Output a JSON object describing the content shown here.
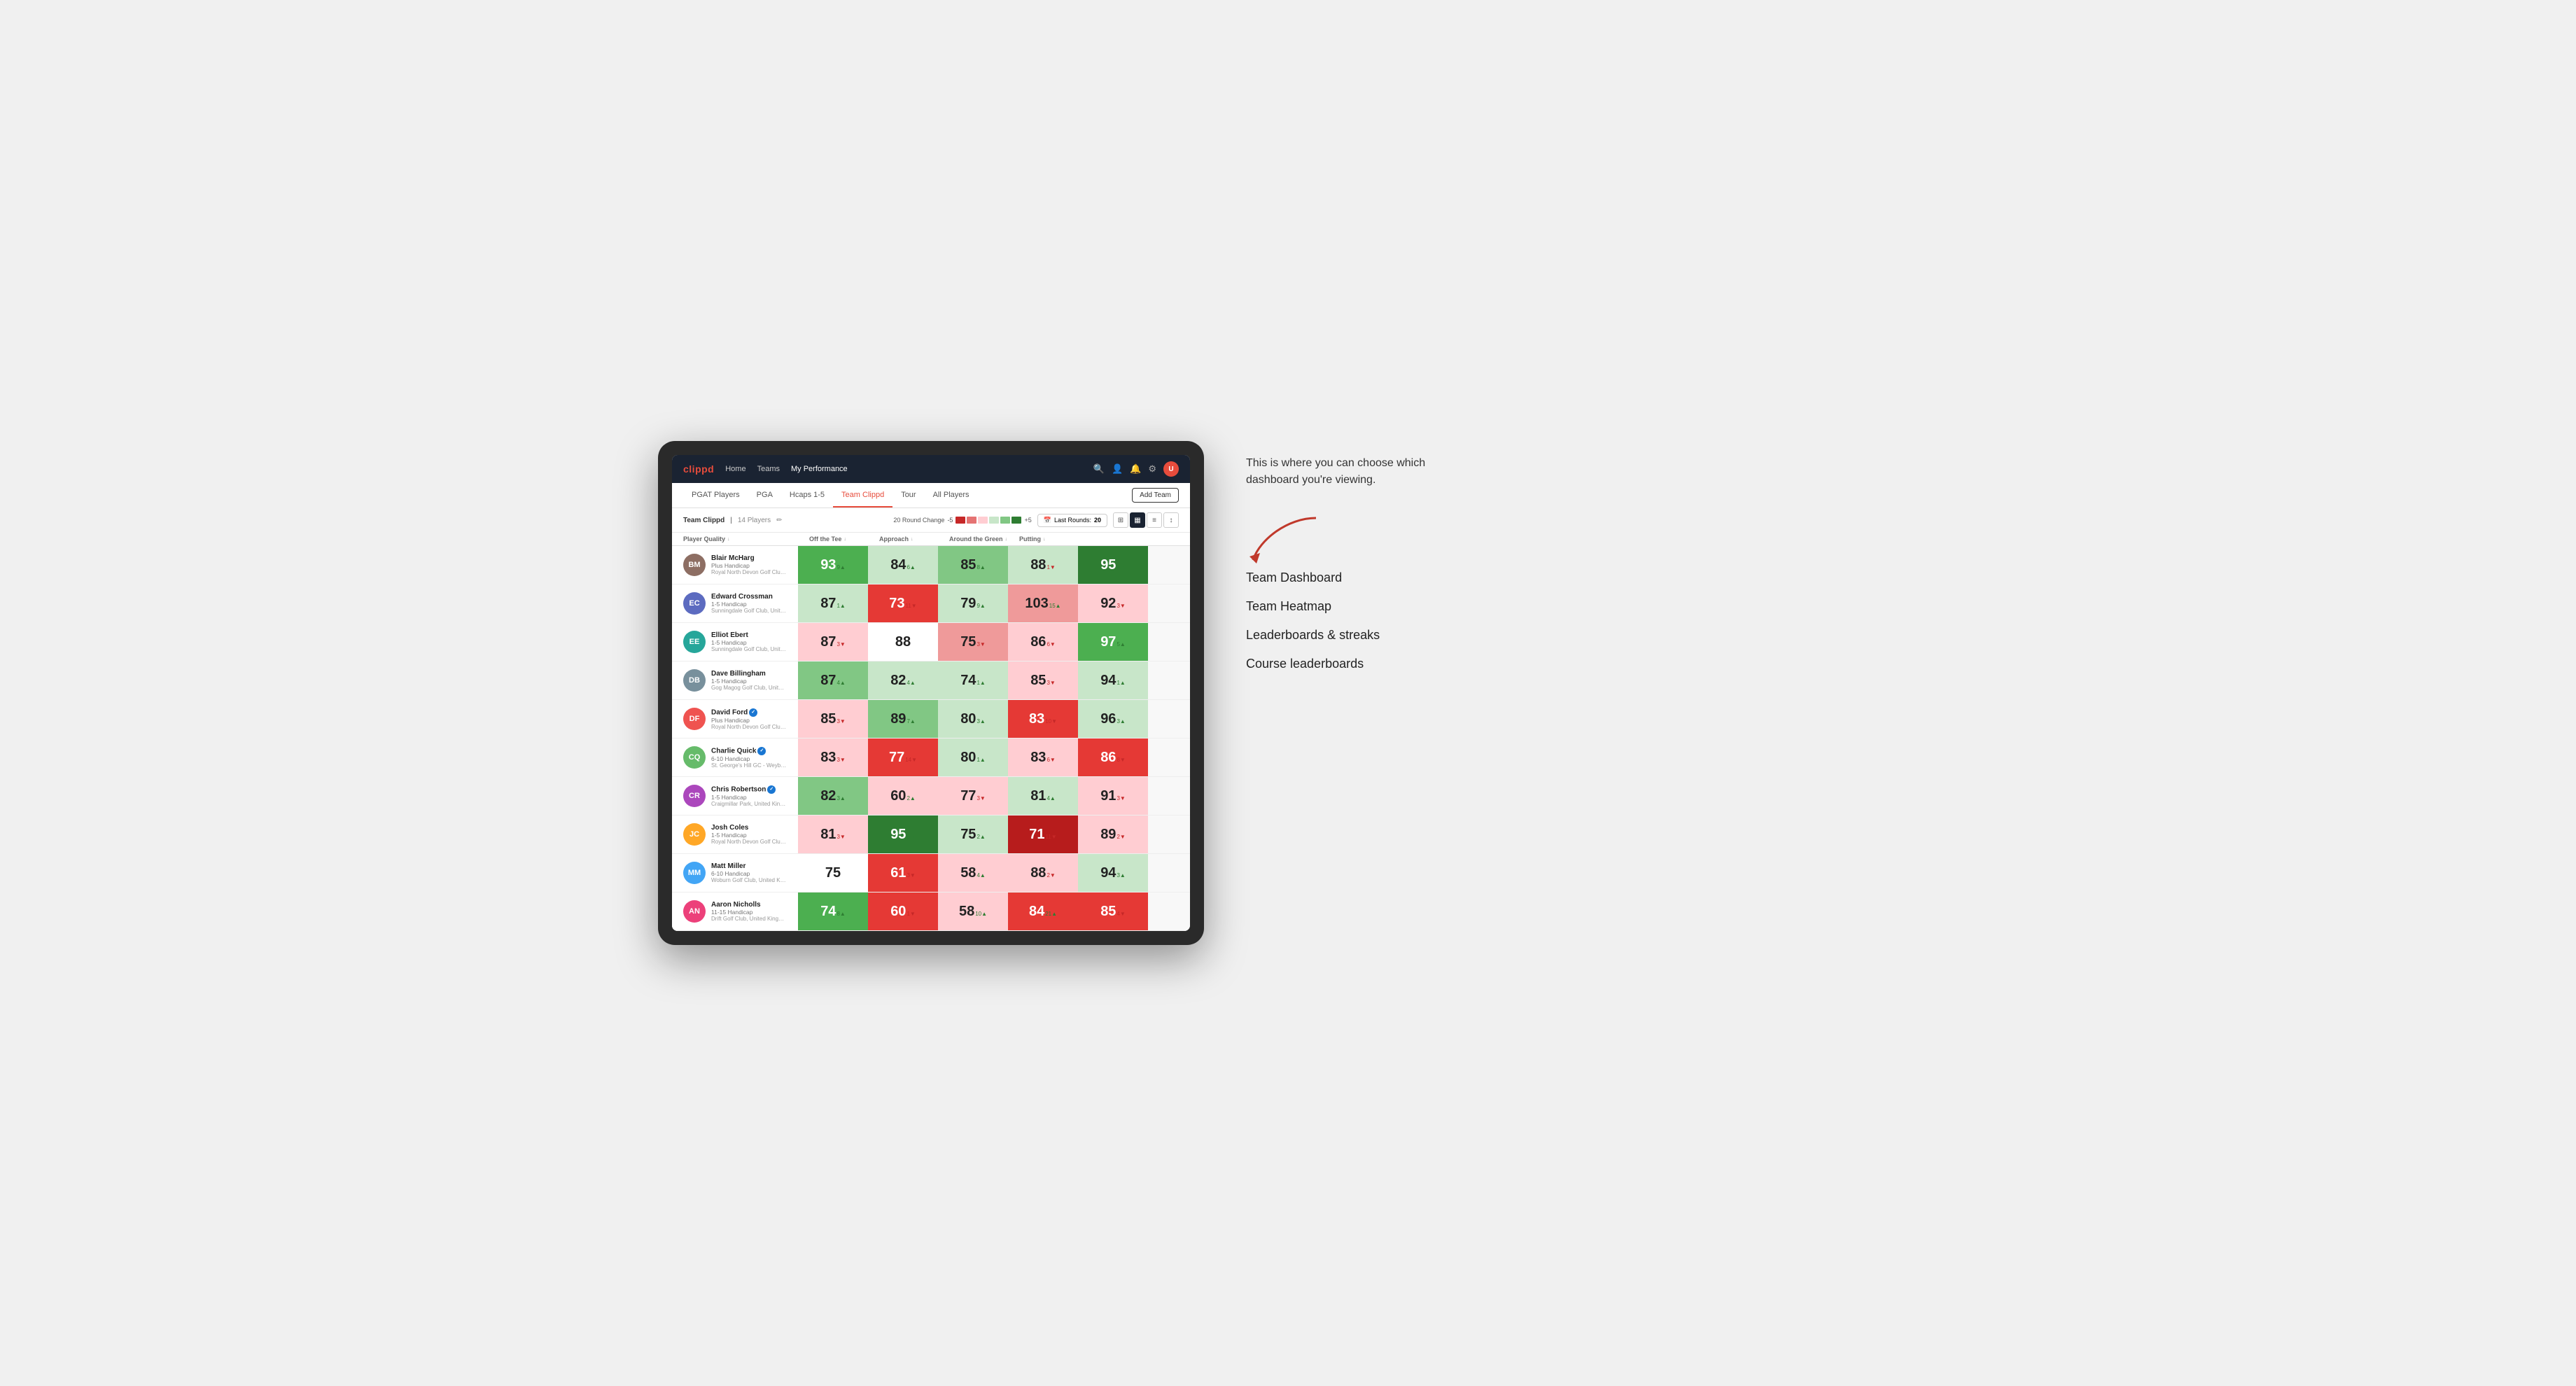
{
  "annotation": {
    "intro_text": "This is where you can choose which dashboard you're viewing.",
    "items": [
      "Team Dashboard",
      "Team Heatmap",
      "Leaderboards & streaks",
      "Course leaderboards"
    ]
  },
  "nav": {
    "logo": "clippd",
    "links": [
      "Home",
      "Teams",
      "My Performance"
    ],
    "active_link": "My Performance"
  },
  "tabs": {
    "items": [
      "PGAT Players",
      "PGA",
      "Hcaps 1-5",
      "Team Clippd",
      "Tour",
      "All Players"
    ],
    "active": "Team Clippd",
    "add_button": "Add Team"
  },
  "sub_header": {
    "title": "Team Clippd",
    "count": "14 Players",
    "round_change_label": "20 Round Change",
    "range_low": "-5",
    "range_high": "+5",
    "last_rounds_label": "Last Rounds:",
    "last_rounds_value": "20"
  },
  "table": {
    "columns": [
      "Player Quality ↓",
      "Off the Tee ↓",
      "Approach ↓",
      "Around the Green ↓",
      "Putting ↓"
    ],
    "rows": [
      {
        "name": "Blair McHarg",
        "handicap": "Plus Handicap",
        "club": "Royal North Devon Golf Club, United Kingdom",
        "initials": "BM",
        "avatar_color": "#8d6e63",
        "scores": [
          {
            "val": "93",
            "change": "9▲",
            "dir": "up",
            "bg": "bg-green-mid",
            "text": "score-dark"
          },
          {
            "val": "84",
            "change": "6▲",
            "dir": "up",
            "bg": "bg-green-pale",
            "text": "score-light"
          },
          {
            "val": "85",
            "change": "8▲",
            "dir": "up",
            "bg": "bg-green-light",
            "text": "score-light"
          },
          {
            "val": "88",
            "change": "1▼",
            "dir": "down",
            "bg": "bg-green-pale",
            "text": "score-light"
          },
          {
            "val": "95",
            "change": "9▲",
            "dir": "up",
            "bg": "bg-green-dark",
            "text": "score-dark"
          }
        ]
      },
      {
        "name": "Edward Crossman",
        "handicap": "1-5 Handicap",
        "club": "Sunningdale Golf Club, United Kingdom",
        "initials": "EC",
        "avatar_color": "#5c6bc0",
        "scores": [
          {
            "val": "87",
            "change": "1▲",
            "dir": "up",
            "bg": "bg-green-pale",
            "text": "score-light"
          },
          {
            "val": "73",
            "change": "11▼",
            "dir": "down",
            "bg": "bg-red-mid",
            "text": "score-dark"
          },
          {
            "val": "79",
            "change": "9▲",
            "dir": "up",
            "bg": "bg-green-pale",
            "text": "score-light"
          },
          {
            "val": "103",
            "change": "15▲",
            "dir": "up",
            "bg": "bg-red-light",
            "text": "score-light"
          },
          {
            "val": "92",
            "change": "3▼",
            "dir": "down",
            "bg": "bg-red-pale",
            "text": "score-light"
          }
        ]
      },
      {
        "name": "Elliot Ebert",
        "handicap": "1-5 Handicap",
        "club": "Sunningdale Golf Club, United Kingdom",
        "initials": "EE",
        "avatar_color": "#26a69a",
        "scores": [
          {
            "val": "87",
            "change": "3▼",
            "dir": "down",
            "bg": "bg-red-pale",
            "text": "score-light"
          },
          {
            "val": "88",
            "change": "",
            "dir": "none",
            "bg": "bg-white",
            "text": "score-light"
          },
          {
            "val": "75",
            "change": "3▼",
            "dir": "down",
            "bg": "bg-red-light",
            "text": "score-light"
          },
          {
            "val": "86",
            "change": "6▼",
            "dir": "down",
            "bg": "bg-red-pale",
            "text": "score-light"
          },
          {
            "val": "97",
            "change": "5▲",
            "dir": "up",
            "bg": "bg-green-mid",
            "text": "score-dark"
          }
        ]
      },
      {
        "name": "Dave Billingham",
        "handicap": "1-5 Handicap",
        "club": "Gog Magog Golf Club, United Kingdom",
        "initials": "DB",
        "avatar_color": "#78909c",
        "scores": [
          {
            "val": "87",
            "change": "4▲",
            "dir": "up",
            "bg": "bg-green-light",
            "text": "score-light"
          },
          {
            "val": "82",
            "change": "4▲",
            "dir": "up",
            "bg": "bg-green-pale",
            "text": "score-light"
          },
          {
            "val": "74",
            "change": "1▲",
            "dir": "up",
            "bg": "bg-green-pale",
            "text": "score-light"
          },
          {
            "val": "85",
            "change": "3▼",
            "dir": "down",
            "bg": "bg-red-pale",
            "text": "score-light"
          },
          {
            "val": "94",
            "change": "1▲",
            "dir": "up",
            "bg": "bg-green-pale",
            "text": "score-light"
          }
        ]
      },
      {
        "name": "David Ford",
        "handicap": "Plus Handicap",
        "club": "Royal North Devon Golf Club, United Kingdom",
        "initials": "DF",
        "avatar_color": "#ef5350",
        "verified": true,
        "scores": [
          {
            "val": "85",
            "change": "3▼",
            "dir": "down",
            "bg": "bg-red-pale",
            "text": "score-light"
          },
          {
            "val": "89",
            "change": "7▲",
            "dir": "up",
            "bg": "bg-green-light",
            "text": "score-light"
          },
          {
            "val": "80",
            "change": "3▲",
            "dir": "up",
            "bg": "bg-green-pale",
            "text": "score-light"
          },
          {
            "val": "83",
            "change": "10▼",
            "dir": "down",
            "bg": "bg-red-mid",
            "text": "score-dark"
          },
          {
            "val": "96",
            "change": "3▲",
            "dir": "up",
            "bg": "bg-green-pale",
            "text": "score-light"
          }
        ]
      },
      {
        "name": "Charlie Quick",
        "handicap": "6-10 Handicap",
        "club": "St. George's Hill GC - Weybridge - Surrey, Uni...",
        "initials": "CQ",
        "avatar_color": "#66bb6a",
        "verified": true,
        "scores": [
          {
            "val": "83",
            "change": "3▼",
            "dir": "down",
            "bg": "bg-red-pale",
            "text": "score-light"
          },
          {
            "val": "77",
            "change": "14▼",
            "dir": "down",
            "bg": "bg-red-mid",
            "text": "score-dark"
          },
          {
            "val": "80",
            "change": "1▲",
            "dir": "up",
            "bg": "bg-green-pale",
            "text": "score-light"
          },
          {
            "val": "83",
            "change": "6▼",
            "dir": "down",
            "bg": "bg-red-pale",
            "text": "score-light"
          },
          {
            "val": "86",
            "change": "8▼",
            "dir": "down",
            "bg": "bg-red-mid",
            "text": "score-dark"
          }
        ]
      },
      {
        "name": "Chris Robertson",
        "handicap": "1-5 Handicap",
        "club": "Craigmillar Park, United Kingdom",
        "initials": "CR",
        "avatar_color": "#ab47bc",
        "verified": true,
        "scores": [
          {
            "val": "82",
            "change": "3▲",
            "dir": "up",
            "bg": "bg-green-light",
            "text": "score-light"
          },
          {
            "val": "60",
            "change": "2▲",
            "dir": "up",
            "bg": "bg-red-pale",
            "text": "score-light"
          },
          {
            "val": "77",
            "change": "3▼",
            "dir": "down",
            "bg": "bg-red-pale",
            "text": "score-light"
          },
          {
            "val": "81",
            "change": "4▲",
            "dir": "up",
            "bg": "bg-green-pale",
            "text": "score-light"
          },
          {
            "val": "91",
            "change": "3▼",
            "dir": "down",
            "bg": "bg-red-pale",
            "text": "score-light"
          }
        ]
      },
      {
        "name": "Josh Coles",
        "handicap": "1-5 Handicap",
        "club": "Royal North Devon Golf Club, United Kingdom",
        "initials": "JC",
        "avatar_color": "#ffa726",
        "scores": [
          {
            "val": "81",
            "change": "3▼",
            "dir": "down",
            "bg": "bg-red-pale",
            "text": "score-light"
          },
          {
            "val": "95",
            "change": "8▲",
            "dir": "up",
            "bg": "bg-green-dark",
            "text": "score-dark"
          },
          {
            "val": "75",
            "change": "2▲",
            "dir": "up",
            "bg": "bg-green-pale",
            "text": "score-light"
          },
          {
            "val": "71",
            "change": "11▼",
            "dir": "down",
            "bg": "bg-red-dark",
            "text": "score-dark"
          },
          {
            "val": "89",
            "change": "2▼",
            "dir": "down",
            "bg": "bg-red-pale",
            "text": "score-light"
          }
        ]
      },
      {
        "name": "Matt Miller",
        "handicap": "6-10 Handicap",
        "club": "Woburn Golf Club, United Kingdom",
        "initials": "MM",
        "avatar_color": "#42a5f5",
        "scores": [
          {
            "val": "75",
            "change": "",
            "dir": "none",
            "bg": "bg-white",
            "text": "score-light"
          },
          {
            "val": "61",
            "change": "3▼",
            "dir": "down",
            "bg": "bg-red-mid",
            "text": "score-dark"
          },
          {
            "val": "58",
            "change": "4▲",
            "dir": "up",
            "bg": "bg-red-pale",
            "text": "score-light"
          },
          {
            "val": "88",
            "change": "2▼",
            "dir": "down",
            "bg": "bg-red-pale",
            "text": "score-light"
          },
          {
            "val": "94",
            "change": "3▲",
            "dir": "up",
            "bg": "bg-green-pale",
            "text": "score-light"
          }
        ]
      },
      {
        "name": "Aaron Nicholls",
        "handicap": "11-15 Handicap",
        "club": "Drift Golf Club, United Kingdom",
        "initials": "AN",
        "avatar_color": "#ec407a",
        "scores": [
          {
            "val": "74",
            "change": "8▲",
            "dir": "up",
            "bg": "bg-green-mid",
            "text": "score-dark"
          },
          {
            "val": "60",
            "change": "1▼",
            "dir": "down",
            "bg": "bg-red-mid",
            "text": "score-dark"
          },
          {
            "val": "58",
            "change": "10▲",
            "dir": "up",
            "bg": "bg-red-pale",
            "text": "score-light"
          },
          {
            "val": "84",
            "change": "21▲",
            "dir": "up",
            "bg": "bg-red-mid",
            "text": "score-dark"
          },
          {
            "val": "85",
            "change": "4▼",
            "dir": "down",
            "bg": "bg-red-mid",
            "text": "score-dark"
          }
        ]
      }
    ]
  }
}
